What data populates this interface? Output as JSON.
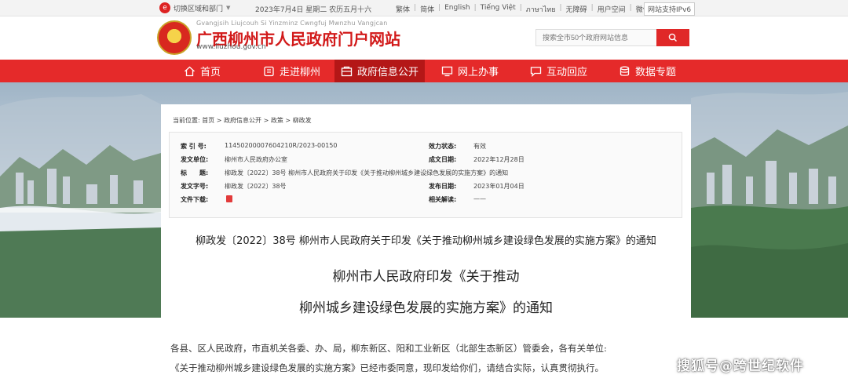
{
  "topbar": {
    "region_label": "切换区域和部门",
    "date_text": "2023年7月4日 星期二 农历五月十六",
    "links": [
      "繁体",
      "简体",
      "English",
      "Tiếng Việt",
      "ภาษาไทย",
      "无障碍",
      "用户空间",
      "微信公众号"
    ],
    "ipv6_text": "网站支持IPv6"
  },
  "header": {
    "pinyin": "Gvangjsih Liujcouh Si Yinzminz Cwngfuj Mwnzhu Vangjcan",
    "title": "广西柳州市人民政府门户网站",
    "domain": "www.liuzhou.gov.cn",
    "search_placeholder": "搜索全市50个政府网站信息"
  },
  "nav": {
    "items": [
      {
        "label": "首页",
        "icon": "home-icon"
      },
      {
        "label": "走进柳州",
        "icon": "building-icon"
      },
      {
        "label": "政府信息公开",
        "icon": "info-icon",
        "active": true
      },
      {
        "label": "网上办事",
        "icon": "monitor-icon"
      },
      {
        "label": "互动回应",
        "icon": "chat-icon"
      },
      {
        "label": "数据专题",
        "icon": "database-icon"
      }
    ],
    "bg_color": "#e52a2a",
    "active_color": "#b41717"
  },
  "breadcrumb": {
    "prefix": "当前位置:",
    "items": [
      "首页",
      "政府信息公开",
      "政策",
      "柳政发"
    ],
    "separator": ">"
  },
  "meta": {
    "index_label": "索 引 号:",
    "index_value": "1145020000760421​0R/2023-00150",
    "issuer_label": "发文单位:",
    "issuer_value": "柳州市人民政府办公室",
    "subject_label": "标　　题:",
    "subject_value": "柳政发〔2022〕38号 柳州市人民政府关于印发《关于推动柳州城乡建设绿色发展的实施方案》的通知",
    "docno_label": "发文字号:",
    "docno_value": "柳政发〔2022〕38号",
    "download_label": "文件下载:",
    "validity_label": "效力状态:",
    "validity_value": "有效",
    "created_label": "成文日期:",
    "created_value": "2022年12月28日",
    "published_label": "发布日期:",
    "published_value": "2023年01月04日",
    "interpret_label": "相关解读:",
    "interpret_value": "——"
  },
  "document": {
    "ref_title": "柳政发〔2022〕38号 柳州市人民政府关于印发《关于推动柳州城乡建设绿色发展的实施方案》的通知",
    "title_line1": "柳州市人民政府印发《关于推动",
    "title_line2": "柳州城乡建设绿色发展的实施方案》的通知",
    "para1": "各县、区人民政府，市直机关各委、办、局，柳东新区、阳和工业新区（北部生态新区）管委会，各有关单位:",
    "para2": "《关于推动柳州城乡建设绿色发展的实施方案》已经市委同意，现印发给你们，请结合实际，认真贯彻执行。"
  },
  "watermark": "搜狐号@跨世纪软件"
}
